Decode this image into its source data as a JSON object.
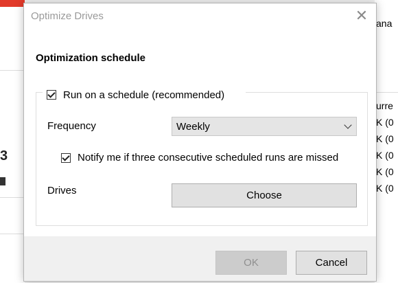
{
  "dialog": {
    "title": "Optimize Drives",
    "close_glyph": "✕",
    "heading": "Optimization schedule",
    "run_on_schedule": {
      "label": "Run on a schedule (recommended)",
      "checked": true
    },
    "frequency": {
      "label": "Frequency",
      "selected": "Weekly"
    },
    "notify": {
      "label": "Notify me if three consecutive scheduled runs are missed",
      "checked": true
    },
    "drives": {
      "label": "Drives",
      "button": "Choose"
    },
    "ok_label": "OK",
    "cancel_label": "Cancel"
  },
  "background": {
    "left_glyph": "3",
    "right_fragments": [
      "ana",
      "urre",
      "K (0",
      "K (0",
      "K (0",
      "K (0",
      "K (0"
    ]
  },
  "icons": {
    "close": "close-icon",
    "dropdown": "chevron-down-icon",
    "checkbox": "checkmark-icon"
  }
}
